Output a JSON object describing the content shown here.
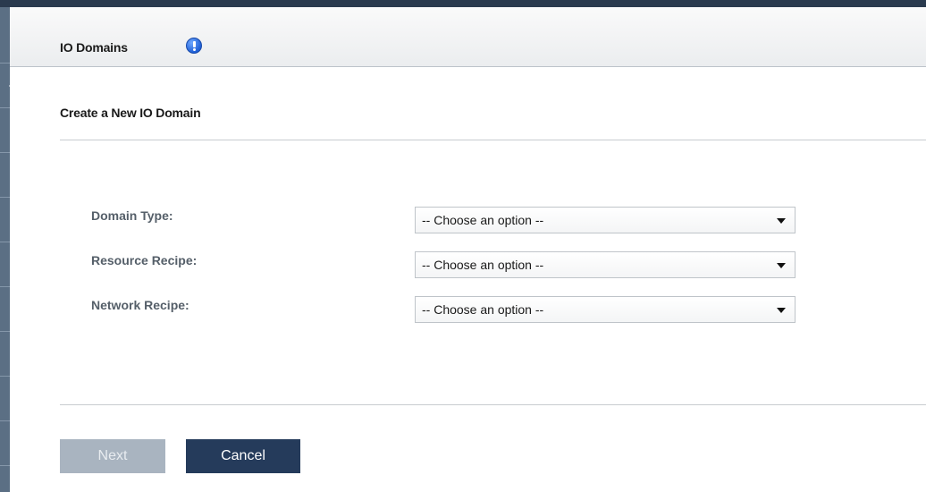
{
  "header": {
    "title": "IO Domains",
    "info_icon": "info-icon"
  },
  "section": {
    "title": "Create a New IO Domain"
  },
  "form": {
    "fields": [
      {
        "label": "Domain Type:",
        "value": "-- Choose an option --"
      },
      {
        "label": "Resource Recipe:",
        "value": "-- Choose an option --"
      },
      {
        "label": "Network Recipe:",
        "value": "-- Choose an option --"
      }
    ]
  },
  "buttons": {
    "next": "Next",
    "cancel": "Cancel"
  },
  "colors": {
    "top_bar": "#2a3a4e",
    "rail": "#5b6f84",
    "cancel_button": "#253b5b",
    "next_button_disabled": "#a9b4c0",
    "label_text": "#555f69"
  }
}
